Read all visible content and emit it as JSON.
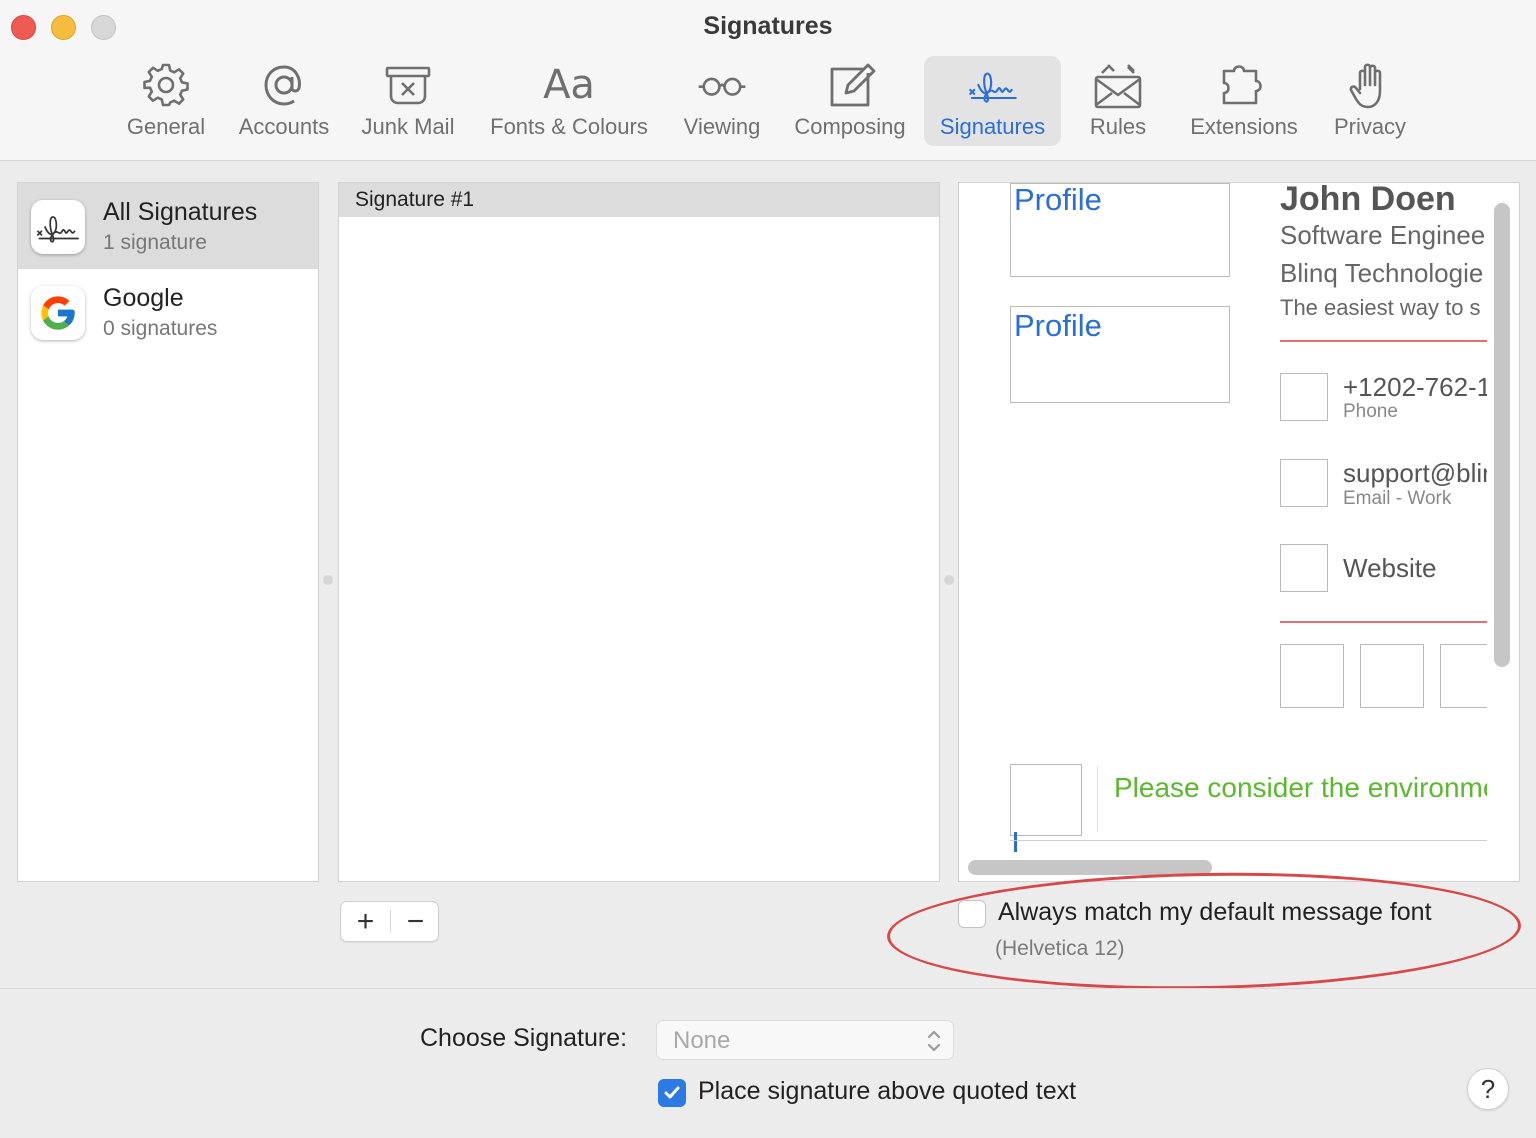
{
  "window": {
    "title": "Signatures"
  },
  "toolbar": {
    "items": [
      {
        "label": "General",
        "icon": "gear-icon"
      },
      {
        "label": "Accounts",
        "icon": "at-sign-icon"
      },
      {
        "label": "Junk Mail",
        "icon": "junk-tray-icon"
      },
      {
        "label": "Fonts & Colours",
        "icon": "font-aa-icon",
        "icon_text": "Aa"
      },
      {
        "label": "Viewing",
        "icon": "glasses-icon"
      },
      {
        "label": "Composing",
        "icon": "compose-pencil-icon"
      },
      {
        "label": "Signatures",
        "icon": "signature-icon",
        "active": true
      },
      {
        "label": "Rules",
        "icon": "rules-envelope-icon"
      },
      {
        "label": "Extensions",
        "icon": "puzzle-icon"
      },
      {
        "label": "Privacy",
        "icon": "hand-icon"
      }
    ],
    "accent_color": "#2a6fd6"
  },
  "accounts": [
    {
      "name": "All Signatures",
      "count": "1 signature",
      "icon": "signature-icon",
      "selected": true
    },
    {
      "name": "Google",
      "count": "0 signatures",
      "icon": "google-g-icon",
      "selected": false
    }
  ],
  "signatures": [
    {
      "name": "Signature #1",
      "selected": true
    }
  ],
  "preview": {
    "profile_1": "Profile",
    "profile_2": "Profile",
    "name": "John Doen",
    "role": "Software Enginee",
    "company": "Blinq Technologie",
    "tagline": "The easiest way to s",
    "phone": "+1202-762-1",
    "phone_label": "Phone",
    "email": "support@blin",
    "email_label": "Email - Work",
    "website": "Website",
    "environment": "Please consider the environme"
  },
  "buttons": {
    "add": "+",
    "remove": "−"
  },
  "font_option": {
    "label": "Always match my default message font",
    "sublabel": "(Helvetica 12)",
    "checked": false
  },
  "footer": {
    "choose_label": "Choose Signature:",
    "choose_value": "None",
    "above_label": "Place signature above quoted text",
    "above_checked": true,
    "help": "?"
  }
}
